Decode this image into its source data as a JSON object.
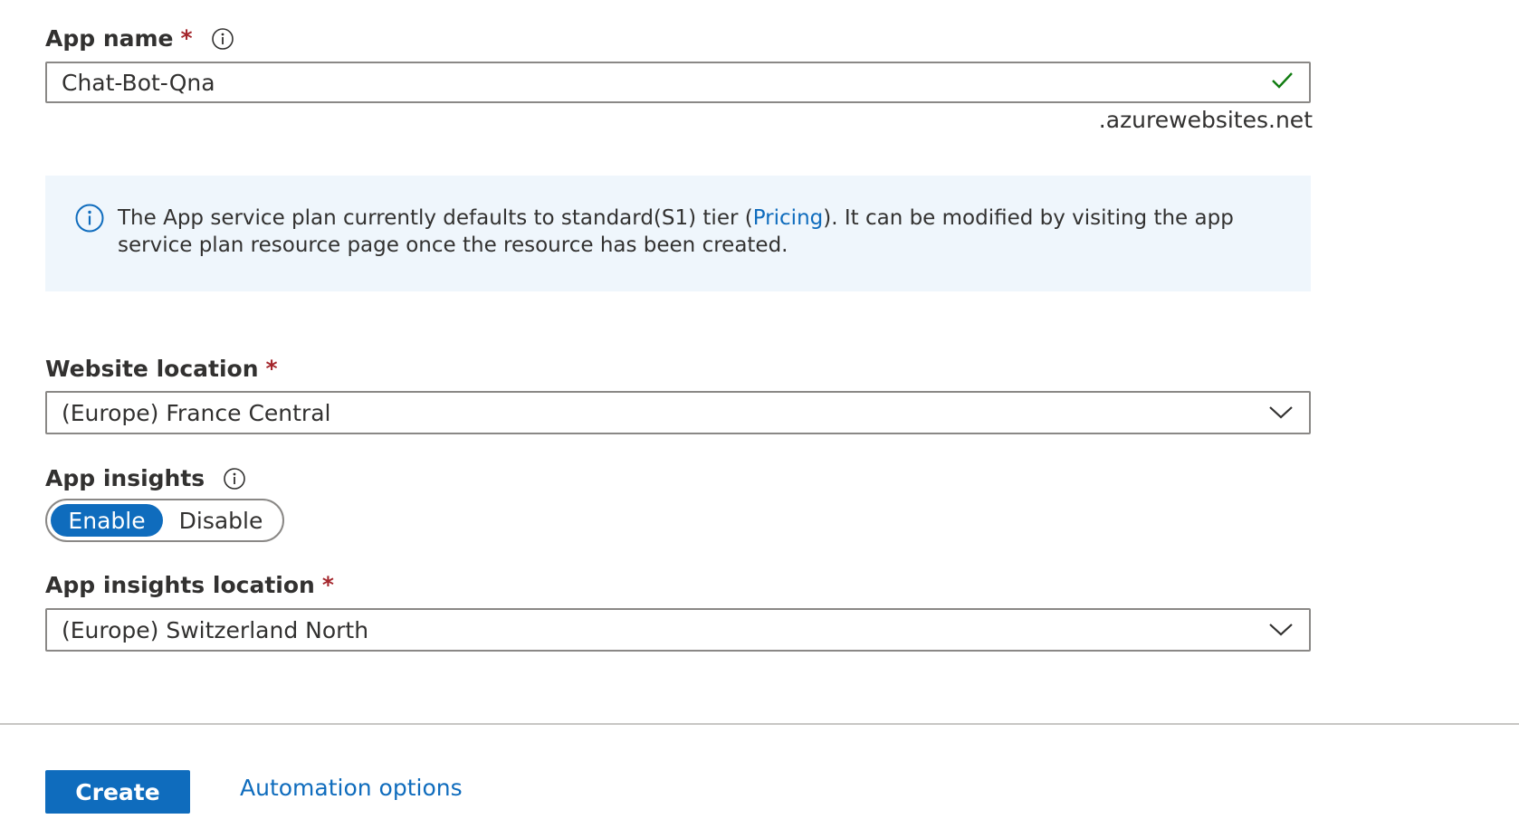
{
  "app_name": {
    "label": "App name",
    "required_mark": "*",
    "value": "Chat-Bot-Qna",
    "suffix": ".azurewebsites.net",
    "validation": "valid"
  },
  "info_banner": {
    "text_before": "The App service plan currently defaults to standard(S1) tier (",
    "link": "Pricing",
    "text_after": "). It can be modified by visiting the app service plan resource page once the resource has been created."
  },
  "website_location": {
    "label": "Website location",
    "required_mark": "*",
    "selected": "(Europe) France Central"
  },
  "app_insights": {
    "label": "App insights",
    "options": [
      "Enable",
      "Disable"
    ],
    "selected": "Enable"
  },
  "app_insights_location": {
    "label": "App insights location",
    "required_mark": "*",
    "selected": "(Europe) Switzerland North"
  },
  "footer": {
    "create_label": "Create",
    "automation_label": "Automation options"
  },
  "colors": {
    "accent": "#0f6cbd",
    "required": "#a4262c",
    "valid": "#107c10",
    "banner_bg": "#eff6fc"
  },
  "icons": {
    "info": "info-icon",
    "check": "check-icon",
    "chevron": "chevron-down-icon"
  }
}
